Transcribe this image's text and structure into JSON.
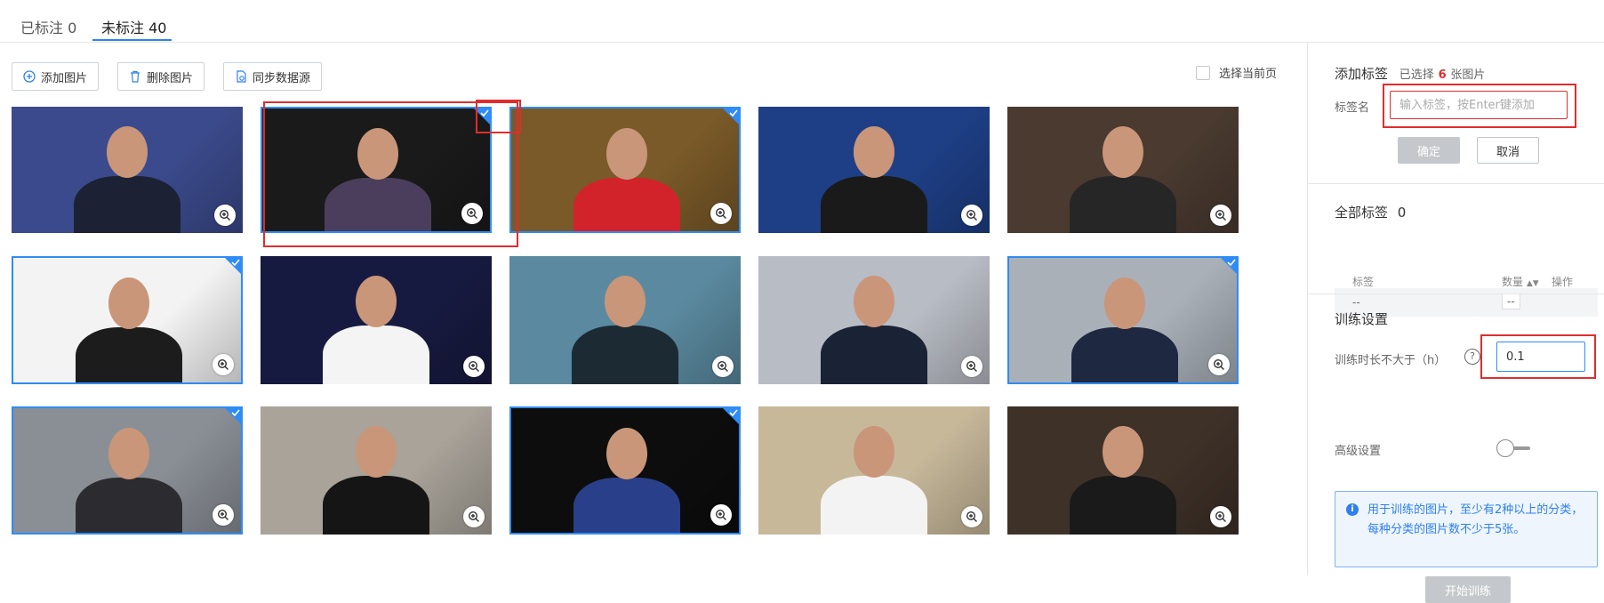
{
  "tabs": [
    {
      "label": "已标注 0"
    },
    {
      "label": "未标注 40"
    }
  ],
  "toolbar": {
    "add_label": "添加图片",
    "delete_label": "删除图片",
    "sync_label": "同步数据源",
    "select_page_label": "选择当前页"
  },
  "images": [
    {
      "selected": false,
      "bg": "#3b4a8c",
      "shirt": "#1c2233"
    },
    {
      "selected": true,
      "bg": "#1a1a1a",
      "shirt": "#4a3e5c"
    },
    {
      "selected": true,
      "bg": "#7a5a28",
      "shirt": "#d2232a"
    },
    {
      "selected": false,
      "bg": "#1e3f86",
      "shirt": "#1a1a1a"
    },
    {
      "selected": false,
      "bg": "#4a3a30",
      "shirt": "#262626"
    },
    {
      "selected": true,
      "bg": "#f3f3f3",
      "shirt": "#1c1c1c"
    },
    {
      "selected": false,
      "bg": "#171a40",
      "shirt": "#f4f4f4"
    },
    {
      "selected": false,
      "bg": "#5b8aa0",
      "shirt": "#1b2a33"
    },
    {
      "selected": false,
      "bg": "#b8bcc4",
      "shirt": "#1a2235"
    },
    {
      "selected": true,
      "bg": "#a9b0b8",
      "shirt": "#1e2840"
    },
    {
      "selected": true,
      "bg": "#8a8f96",
      "shirt": "#2c2c30"
    },
    {
      "selected": false,
      "bg": "#a9a39a",
      "shirt": "#151515"
    },
    {
      "selected": true,
      "bg": "#0d0d0d",
      "shirt": "#2a3f8a"
    },
    {
      "selected": false,
      "bg": "#c7b89a",
      "shirt": "#f3f3f3"
    },
    {
      "selected": false,
      "bg": "#3e3128",
      "shirt": "#1a1a1a"
    }
  ],
  "panel": {
    "add_tag": {
      "title": "添加标签",
      "selected_prefix": "已选择",
      "selected_count": "6",
      "selected_suffix": "张图片",
      "field_label": "标签名",
      "placeholder": "输入标签，按Enter键添加",
      "confirm_label": "确定",
      "cancel_label": "取消"
    },
    "all_tags": {
      "title": "全部标签",
      "count": "0",
      "col_tag": "标签",
      "col_count": "数量",
      "col_action": "操作",
      "row_tag": "--",
      "row_count": "--"
    },
    "training": {
      "title": "训练设置",
      "duration_label": "训练时长不大于（h）",
      "duration_value": "0.1",
      "advanced_label": "高级设置",
      "info_text": "用于训练的图片，至少有2种以上的分类，每种分类的图片数不少于5张。",
      "start_label": "开始训练"
    }
  },
  "colors": {
    "accent": "#2f8cf5",
    "highlight": "#e02d2d"
  }
}
